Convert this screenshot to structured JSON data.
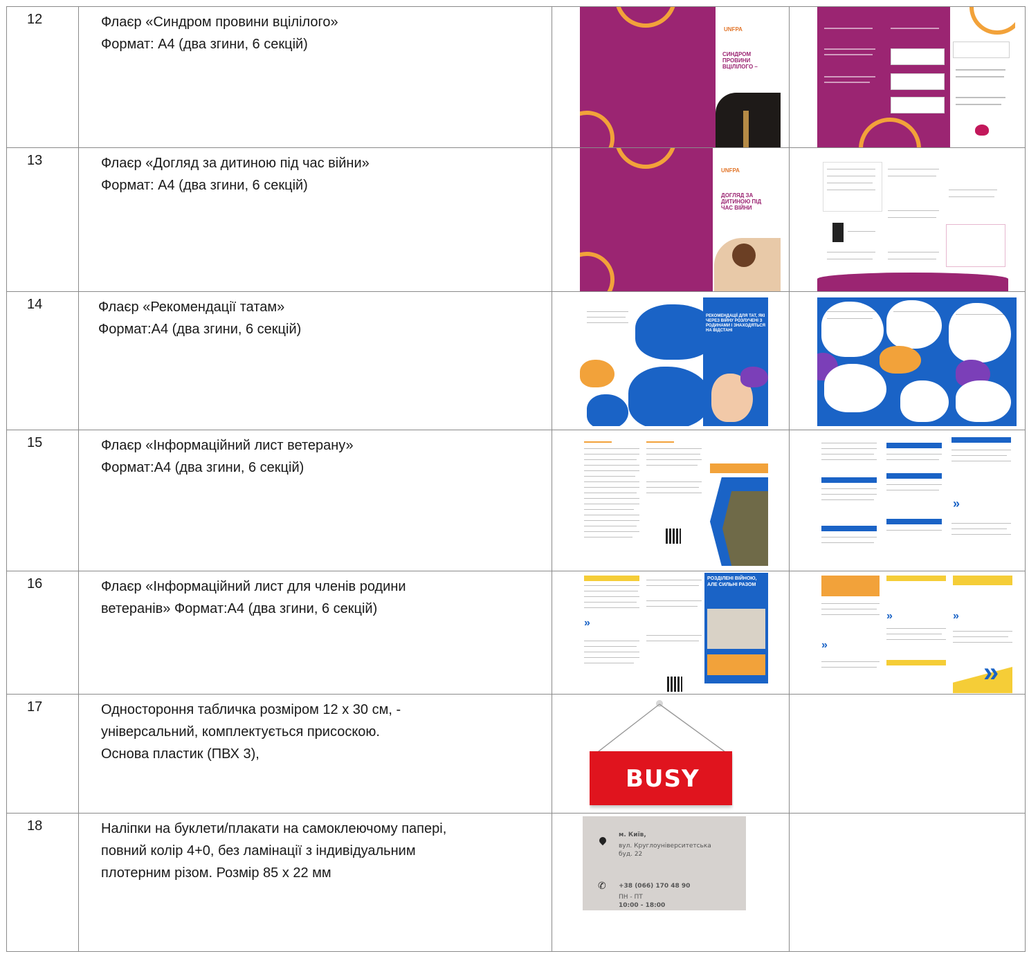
{
  "rows": [
    {
      "num": "12",
      "lines": [
        "Флаєр «Синдром провини вцілілого»",
        "Формат: А4 (два згини, 6 секцій)"
      ]
    },
    {
      "num": "13",
      "lines": [
        "Флаєр «Догляд за дитиною під час війни»",
        "Формат: А4 (два згини, 6 секцій)"
      ]
    },
    {
      "num": "14",
      "lines": [
        "Флаєр «Рекомендації татам»",
        "Формат:А4 (два згини, 6 секцій)"
      ]
    },
    {
      "num": "15",
      "lines": [
        "Флаєр «Інформаційний лист ветерану»",
        "Формат:А4 (два згини, 6 секцій)"
      ]
    },
    {
      "num": "16",
      "lines": [
        "Флаєр «Інформаційний лист для членів родини",
        "ветеранів»  Формат:А4 (два згини, 6 секцій)"
      ]
    },
    {
      "num": "17",
      "lines": [
        "Одностороння табличка розміром 12 х 30 см, -",
        "універсальний, комплектується присоскою.",
        "Основа пластик (ПВХ 3),"
      ]
    },
    {
      "num": "18",
      "lines": [
        "Наліпки на буклети/плакати  на самоклеючому папері,",
        "повний колір 4+0, без ламінації з індивідуальним",
        "плотерним різом. Розмір 85 х 22 мм"
      ]
    }
  ],
  "thumbs": {
    "row12_cover_title": "СИНДРОМ ПРОВИНИ ВЦІЛІЛОГО –",
    "row13_cover_title": "ДОГЛЯД ЗА ДИТИНОЮ ПІД ЧАС ВІЙНИ",
    "row14_cover_title": "РЕКОМЕНДАЦІЇ ДЛЯ ТАТ, ЯКІ ЧЕРЕЗ ВІЙНУ РОЗЛУЧЕНІ З РОДИНАМИ І ЗНАХОДЯТЬСЯ НА ВІДСТАНІ",
    "row16_cover_title": "РОЗДІЛЕНІ ВІЙНОЮ, АЛЕ СИЛЬНІ РАЗОМ",
    "busy_sign_text": "BUSY",
    "sticker": {
      "city": "м. Київ,",
      "street": "вул. Круглоуніверситетська",
      "building": "буд. 22",
      "phone": "+38 (066) 170 48 90",
      "days": "ПН - ПТ",
      "hours": "10:00 - 18:00"
    }
  },
  "colors": {
    "border": "#8a8a8a",
    "magenta": "#9b2572",
    "orange": "#f2a23a",
    "blue": "#1a63c6",
    "sign_red": "#e0141e"
  }
}
